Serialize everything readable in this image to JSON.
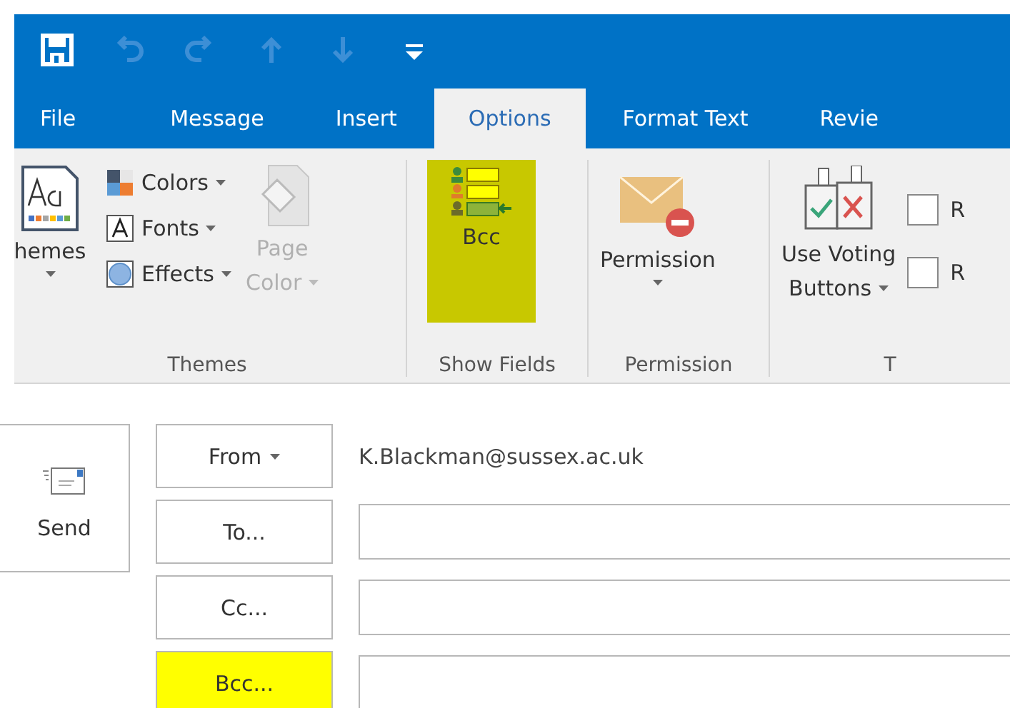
{
  "quick_access": [
    {
      "kind": "save",
      "disabled": false
    },
    {
      "kind": "undo",
      "disabled": true
    },
    {
      "kind": "redo",
      "disabled": true
    },
    {
      "kind": "up",
      "disabled": true
    },
    {
      "kind": "down",
      "disabled": true
    },
    {
      "kind": "customize",
      "disabled": false
    }
  ],
  "tabs": [
    {
      "label": "File",
      "selected": false
    },
    {
      "label": "Message",
      "selected": false
    },
    {
      "label": "Insert",
      "selected": false
    },
    {
      "label": "Options",
      "selected": true
    },
    {
      "label": "Format Text",
      "selected": false
    },
    {
      "label": "Revie",
      "selected": false
    }
  ],
  "ribbon": {
    "groups": [
      {
        "label": "Themes",
        "items": [
          {
            "kind": "themes",
            "label": "hemes"
          },
          {
            "kind": "small",
            "items": [
              {
                "kind": "colors",
                "label": "Colors"
              },
              {
                "kind": "fonts",
                "label": "Fonts"
              },
              {
                "kind": "effects",
                "label": "Effects"
              }
            ]
          },
          {
            "kind": "pagecolor",
            "lines": [
              "Page",
              "Color"
            ],
            "disabled": true
          }
        ]
      },
      {
        "label": "Show Fields",
        "items": [
          {
            "kind": "bcc",
            "label": "Bcc",
            "highlighted": true
          }
        ]
      },
      {
        "label": "Permission",
        "items": [
          {
            "kind": "permission",
            "label": "Permission"
          }
        ]
      },
      {
        "label": "T",
        "items": [
          {
            "kind": "voting",
            "lines": [
              "Use Voting",
              "Buttons"
            ]
          },
          {
            "kind": "checks",
            "items": [
              {
                "label": "R",
                "checked": false
              },
              {
                "label": "R",
                "checked": false
              }
            ]
          }
        ]
      }
    ]
  },
  "compose": {
    "send": "Send",
    "from": {
      "label": "From",
      "value": "K.Blackman@sussex.ac.uk"
    },
    "fields": [
      {
        "label": "To...",
        "highlighted": false
      },
      {
        "label": "Cc...",
        "highlighted": false
      },
      {
        "label": "Bcc...",
        "highlighted": true
      }
    ]
  }
}
